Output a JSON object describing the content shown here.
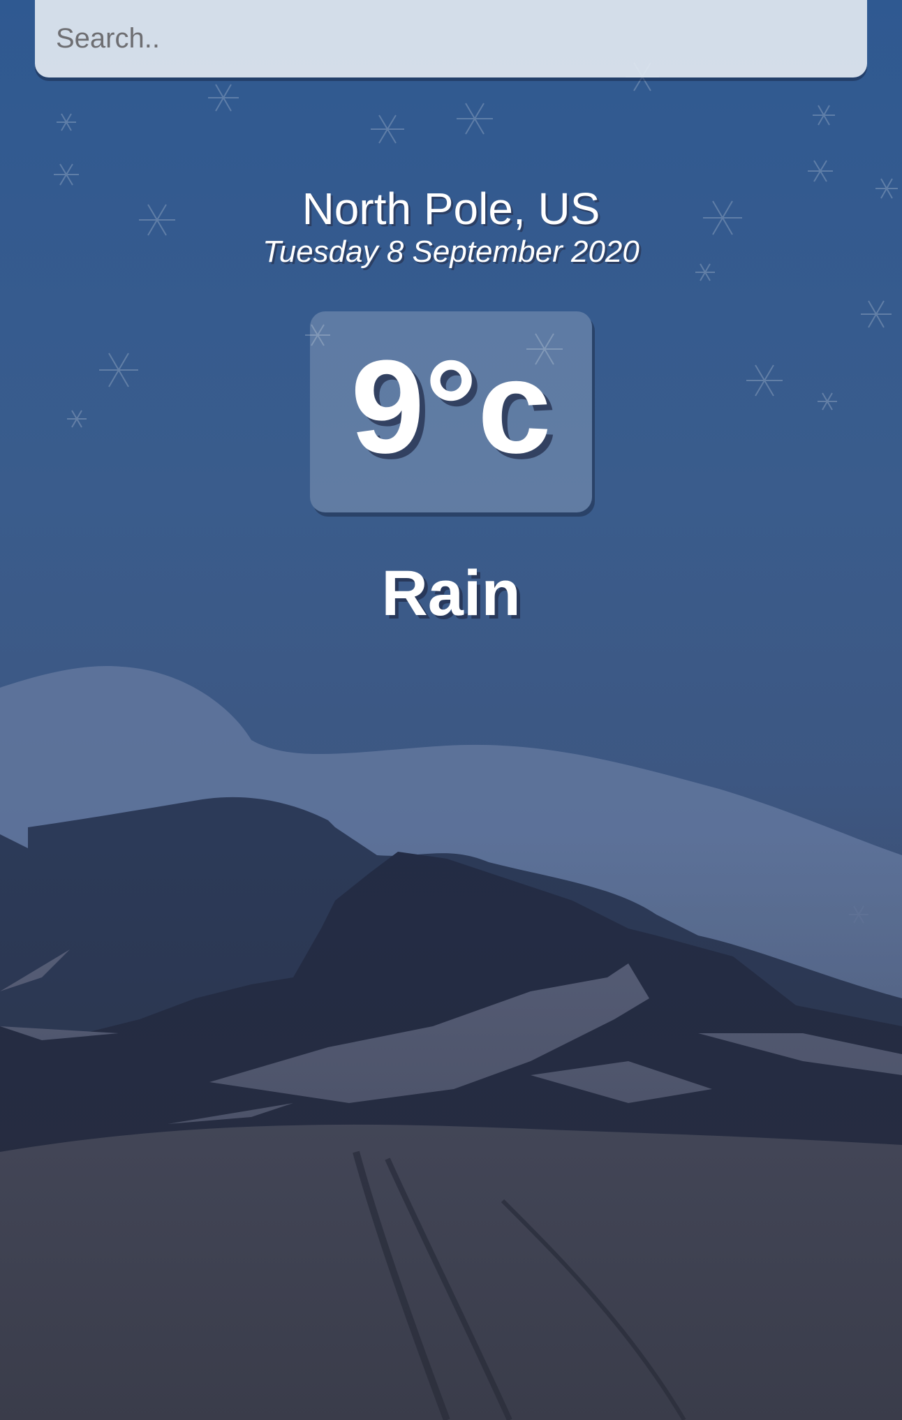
{
  "search": {
    "placeholder": "Search.."
  },
  "location": {
    "name": "North Pole, US",
    "date": "Tuesday 8 September 2020"
  },
  "weather": {
    "temperature": "9°c",
    "condition": "Rain"
  },
  "background": {
    "scene": "snowy-mountain-night",
    "icon": "snowflake-icon"
  },
  "colors": {
    "sky_top": "#2f5991",
    "sky_bottom": "#34353d",
    "text": "#ffffff"
  }
}
